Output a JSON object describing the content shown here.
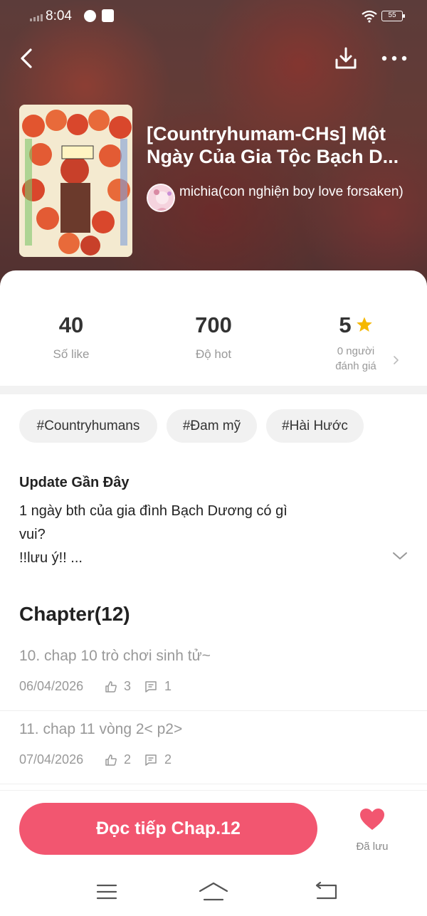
{
  "status_bar": {
    "time": "8:04",
    "battery": "55"
  },
  "story": {
    "title_line1": "[Countryhumam-CHs] Một",
    "title_line2": "Ngày Của Gia Tộc Bạch D...",
    "author": "michia(con nghiện boy love forsaken)"
  },
  "stats": {
    "likes_value": "40",
    "likes_label": "Số like",
    "hot_value": "700",
    "hot_label": "Độ hot",
    "rating_value": "5",
    "rating_label_line1": "0 người",
    "rating_label_line2": "đánh giá"
  },
  "tags": [
    "#Countryhumans",
    "#Đam mỹ",
    "#Hài Hước"
  ],
  "update": {
    "title": "Update Gần Đây",
    "line1": "1 ngày bth của gia đình Bạch Dương có gì",
    "line2": "vui?",
    "line3": "!!lưu ý!! ..."
  },
  "chapters": {
    "heading": "Chapter(12)",
    "items": [
      {
        "name": "10. chap 10 trò chơi sinh tử~",
        "date": "06/04/2026",
        "likes": "3",
        "comments": "1"
      },
      {
        "name": "11. chap 11 vòng 2< p2>",
        "date": "07/04/2026",
        "likes": "2",
        "comments": "2"
      }
    ]
  },
  "actions": {
    "read_label": "Đọc tiếp Chap.12",
    "saved_label": "Đã lưu"
  },
  "colors": {
    "accent": "#f25670",
    "star": "#f5b800"
  }
}
